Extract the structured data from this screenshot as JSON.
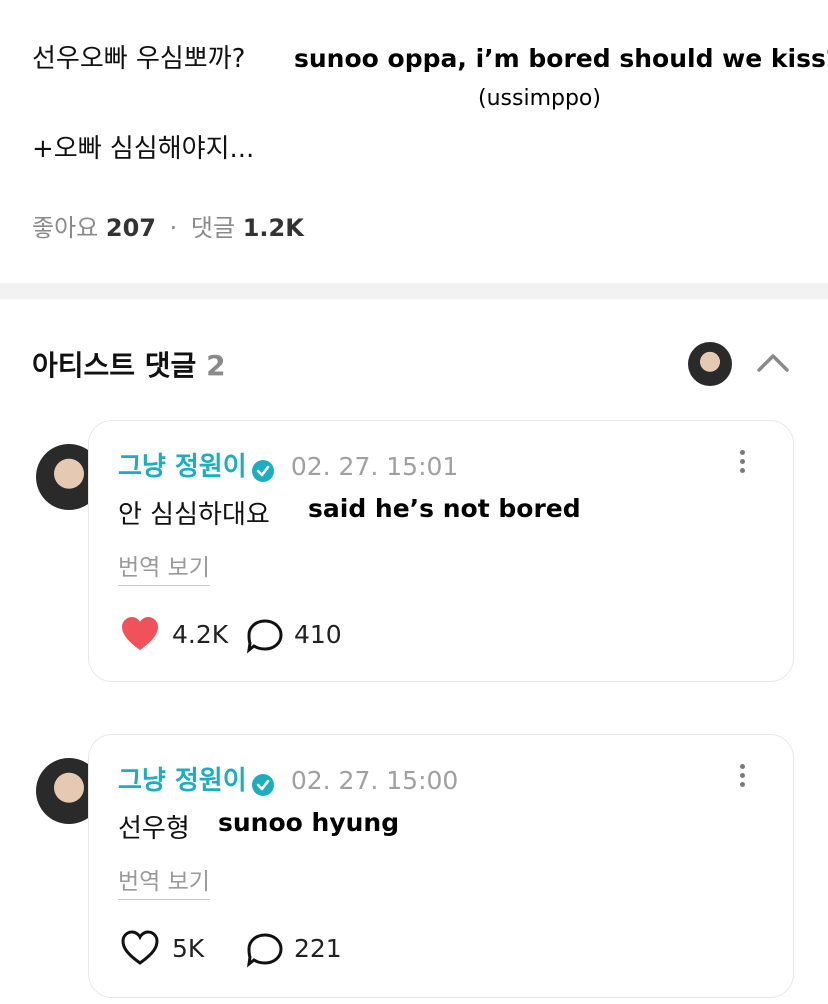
{
  "post": {
    "line1": "선우오빠 우심뽀까?",
    "line2": "+오빠 심심해야지...",
    "overlay_translation": "sunoo oppa, i’m bored should we kiss?",
    "overlay_note": "(ussimppo)",
    "likes_label": "좋아요",
    "likes_count": "207",
    "separator": "·",
    "comments_label": "댓글",
    "comments_count": "1.2K"
  },
  "artist_comments": {
    "title": "아티스트 댓글",
    "count": "2",
    "collapse_icon": "chevron-up-icon"
  },
  "comments": [
    {
      "author": "그냥 정원이",
      "verified": true,
      "date": "02. 27. 15:01",
      "text": "안 심심하대요",
      "overlay": "said he’s not bored",
      "translate_label": "번역 보기",
      "likes": "4.2K",
      "liked": true,
      "replies": "410"
    },
    {
      "author": "그냥 정원이",
      "verified": true,
      "date": "02. 27. 15:00",
      "text": "선우형",
      "overlay": "sunoo hyung",
      "translate_label": "번역 보기",
      "likes": "5K",
      "liked": false,
      "replies": "221"
    }
  ],
  "colors": {
    "accent": "#1aaec0",
    "heart": "#f0525a",
    "muted": "#8a8a8a"
  }
}
